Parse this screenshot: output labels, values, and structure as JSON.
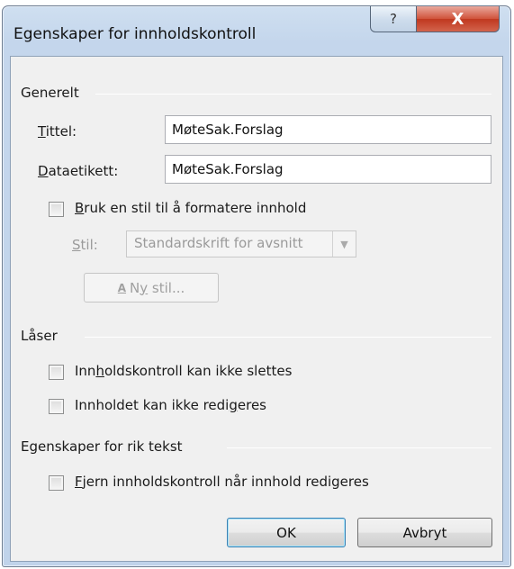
{
  "window": {
    "title": "Egenskaper for innholdskontroll",
    "help_symbol": "?",
    "close_symbol": "X"
  },
  "general": {
    "heading": "Generelt",
    "title_label": "Tittel:",
    "title_value": "MøteSak.Forslag",
    "tag_label": "Dataetikett:",
    "tag_value": "MøteSak.Forslag",
    "use_style_label": "Bruk en stil til å formatere innhold",
    "use_style_checked": false,
    "style_label": "Stil:",
    "style_value": "Standardskrift for avsnitt",
    "new_style_label": "Ny stil..."
  },
  "locking": {
    "heading": "Låser",
    "cannot_delete_label": "Innholdskontroll kan ikke slettes",
    "cannot_delete_checked": false,
    "cannot_edit_label": "Innholdet kan ikke redigeres",
    "cannot_edit_checked": false
  },
  "rich_text": {
    "heading": "Egenskaper for rik tekst",
    "remove_label": "Fjern innholdskontroll når innhold redigeres",
    "remove_checked": false
  },
  "buttons": {
    "ok": "OK",
    "cancel": "Avbryt"
  }
}
